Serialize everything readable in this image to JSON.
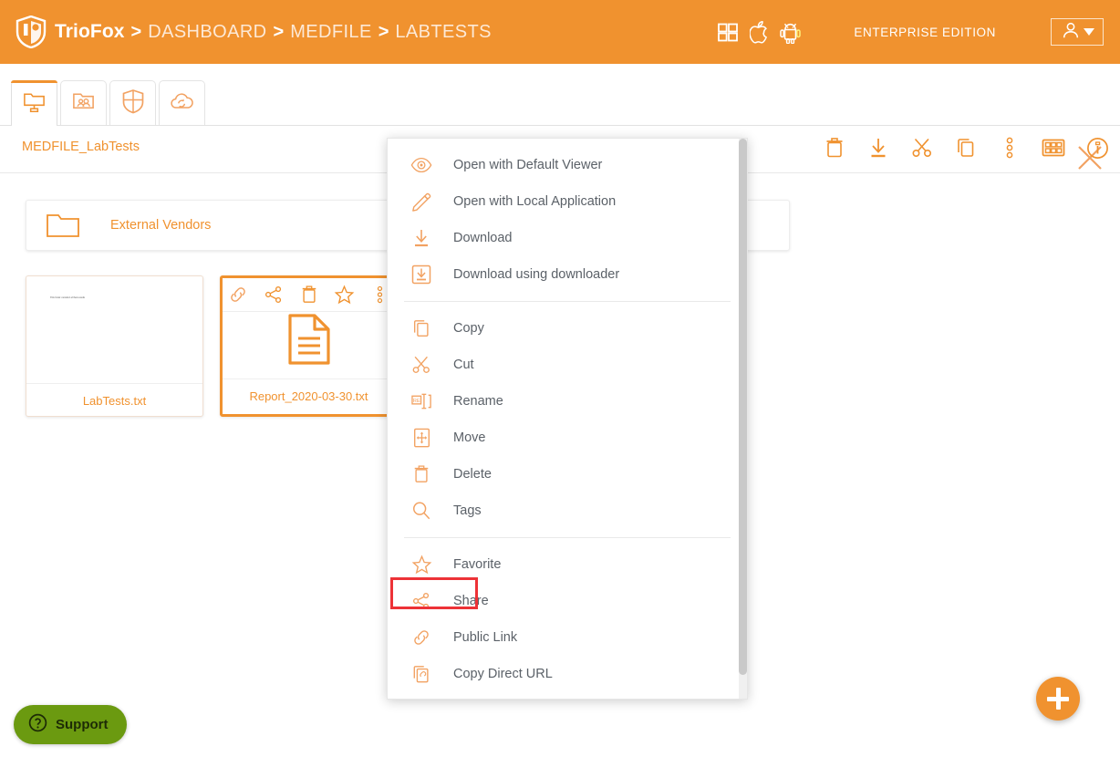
{
  "colors": {
    "brand_orange": "#F0922F",
    "breadcrumb_text": "#FDE9D6",
    "menu_text": "#5b6168",
    "highlight_red": "#ED3237",
    "support_green": "#6B9A10"
  },
  "header": {
    "logo": "triofox-shield-logo",
    "brand": "TrioFox",
    "breadcrumb": [
      {
        "sep": ">",
        "label": "DASHBOARD"
      },
      {
        "sep": ">",
        "label": "MEDFILE"
      },
      {
        "sep": ">",
        "label": "LABTESTS"
      }
    ],
    "platform_icons": [
      "windows-icon",
      "apple-icon",
      "android-icon"
    ],
    "edition": "ENTERPRISE EDITION",
    "user_menu": {
      "icon": "user-avatar-icon",
      "caret": "chevron-down-icon"
    }
  },
  "tabbar": {
    "tabs": [
      {
        "name": "my-network-folders",
        "icon": "network-folder-icon",
        "active": true
      },
      {
        "name": "team-folders",
        "icon": "team-folder-icon",
        "active": false
      },
      {
        "name": "security",
        "icon": "shield-icon",
        "active": false
      },
      {
        "name": "cloud-sync",
        "icon": "cloud-sync-icon",
        "active": false
      }
    ],
    "close_icon": "close-icon"
  },
  "pathbar": {
    "current_path": "MEDFILE_LabTests",
    "tools": [
      {
        "name": "delete-button",
        "icon": "trash-icon"
      },
      {
        "name": "download-button",
        "icon": "download-icon"
      },
      {
        "name": "cut-button",
        "icon": "scissors-icon"
      },
      {
        "name": "copy-button",
        "icon": "copy-icon"
      },
      {
        "name": "more-button",
        "icon": "more-vertical-icon"
      },
      {
        "name": "grid-view-button",
        "icon": "grid-icon"
      },
      {
        "name": "info-button",
        "icon": "info-circle-icon"
      }
    ]
  },
  "content": {
    "folder_row": {
      "icon": "folder-icon",
      "name": "External Vendors"
    },
    "tiles": [
      {
        "name": "LabTests.txt",
        "thumbnail_type": "text-preview",
        "preview_text": "This folder contains LabTests results",
        "selected": false
      },
      {
        "name": "Report_2020-03-30.txt",
        "thumbnail_type": "text-file-icon",
        "selected": true,
        "hover_actions": [
          {
            "name": "public-link-action",
            "icon": "link-icon"
          },
          {
            "name": "share-action",
            "icon": "share-nodes-icon"
          },
          {
            "name": "delete-action",
            "icon": "trash-icon"
          },
          {
            "name": "favorite-action",
            "icon": "star-icon"
          },
          {
            "name": "more-action",
            "icon": "more-vertical-icon"
          }
        ]
      }
    ]
  },
  "context_menu": {
    "groups": [
      {
        "items": [
          {
            "label": "Open with Default Viewer",
            "icon": "eye-icon",
            "name": "open-with-default-viewer"
          },
          {
            "label": "Open with Local Application",
            "icon": "pencil-icon",
            "name": "open-with-local-application"
          },
          {
            "label": "Download",
            "icon": "download-icon",
            "name": "download"
          },
          {
            "label": "Download using downloader",
            "icon": "download-box-icon",
            "name": "download-using-downloader"
          }
        ]
      },
      {
        "items": [
          {
            "label": "Copy",
            "icon": "copy-icon",
            "name": "copy"
          },
          {
            "label": "Cut",
            "icon": "scissors-icon",
            "name": "cut"
          },
          {
            "label": "Rename",
            "icon": "rename-icon",
            "name": "rename"
          },
          {
            "label": "Move",
            "icon": "move-icon",
            "name": "move"
          },
          {
            "label": "Delete",
            "icon": "trash-icon",
            "name": "delete"
          },
          {
            "label": "Tags",
            "icon": "magnifier-icon",
            "name": "tags"
          }
        ]
      },
      {
        "items": [
          {
            "label": "Favorite",
            "icon": "star-icon",
            "name": "favorite"
          },
          {
            "label": "Share",
            "icon": "share-nodes-icon",
            "name": "share",
            "highlighted": true
          },
          {
            "label": "Public Link",
            "icon": "link-icon",
            "name": "public-link"
          },
          {
            "label": "Copy Direct URL",
            "icon": "copy-link-icon",
            "name": "copy-direct-url"
          }
        ]
      }
    ],
    "scrollbar": {
      "visible": true
    }
  },
  "footer": {
    "support": {
      "label": "Support",
      "icon": "question-circle-icon"
    },
    "fab": {
      "icon": "plus-icon",
      "name": "add-button"
    }
  }
}
